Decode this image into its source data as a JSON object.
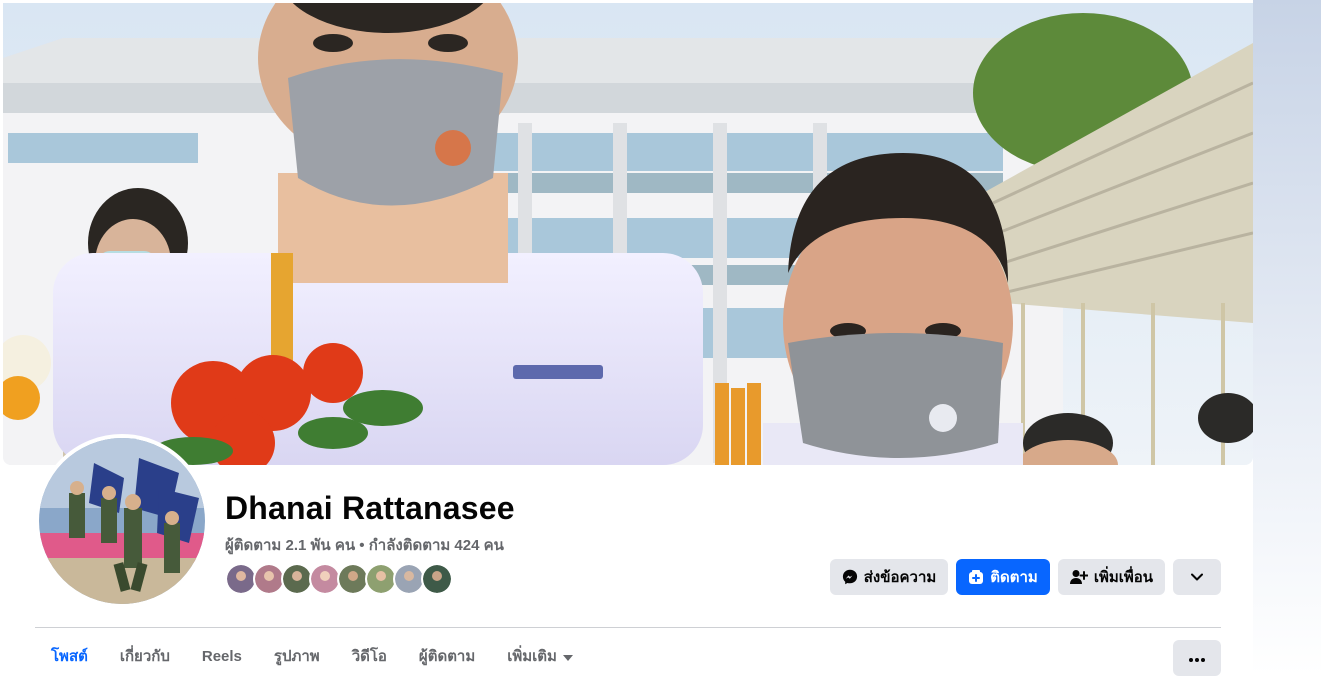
{
  "profile": {
    "name": "Dhanai Rattanasee",
    "stats": "ผู้ติดตาม 2.1 พัน คน • กำลังติดตาม 424 คน"
  },
  "friends_preview": [
    {
      "color": "#7a6a8a"
    },
    {
      "color": "#b07a8a"
    },
    {
      "color": "#5b6a4e"
    },
    {
      "color": "#c48aa0"
    },
    {
      "color": "#6d7a5a"
    },
    {
      "color": "#8ea070"
    },
    {
      "color": "#9aa4b4"
    },
    {
      "color": "#3e5a48"
    }
  ],
  "actions": {
    "message_label": "ส่งข้อความ",
    "follow_label": "ติดตาม",
    "add_friend_label": "เพิ่มเพื่อน"
  },
  "tabs": [
    {
      "label": "โพสต์",
      "active": true
    },
    {
      "label": "เกี่ยวกับ"
    },
    {
      "label": "Reels"
    },
    {
      "label": "รูปภาพ"
    },
    {
      "label": "วิดีโอ"
    },
    {
      "label": "ผู้ติดตาม"
    },
    {
      "label": "เพิ่มเติม"
    }
  ],
  "colors": {
    "accent": "#0866ff",
    "secondary_button": "#e4e6eb",
    "muted_text": "#65676b"
  },
  "icons": {
    "message": "messenger-icon",
    "follow": "follow-icon",
    "add_friend": "add-friend-icon",
    "dropdown": "chevron-down-icon",
    "more": "more-dots-icon"
  }
}
